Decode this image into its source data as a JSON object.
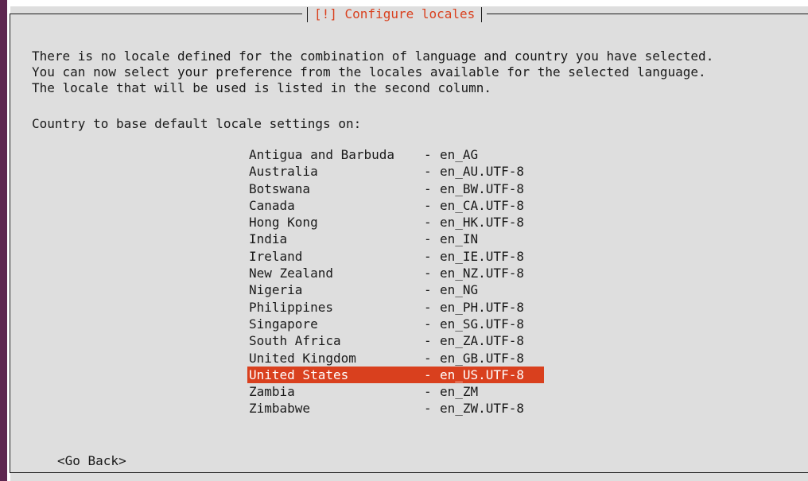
{
  "dialog": {
    "title": "[!] Configure locales",
    "description_lines": [
      "There is no locale defined for the combination of language and country you have selected.",
      "You can now select your preference from the locales available for the selected language.",
      "The locale that will be used is listed in the second column."
    ],
    "prompt": "Country to base default locale settings on:",
    "separator": "-",
    "selected_country": "United States",
    "locales": [
      {
        "country": "Antigua and Barbuda",
        "locale": "en_AG"
      },
      {
        "country": "Australia",
        "locale": "en_AU.UTF-8"
      },
      {
        "country": "Botswana",
        "locale": "en_BW.UTF-8"
      },
      {
        "country": "Canada",
        "locale": "en_CA.UTF-8"
      },
      {
        "country": "Hong Kong",
        "locale": "en_HK.UTF-8"
      },
      {
        "country": "India",
        "locale": "en_IN"
      },
      {
        "country": "Ireland",
        "locale": "en_IE.UTF-8"
      },
      {
        "country": "New Zealand",
        "locale": "en_NZ.UTF-8"
      },
      {
        "country": "Nigeria",
        "locale": "en_NG"
      },
      {
        "country": "Philippines",
        "locale": "en_PH.UTF-8"
      },
      {
        "country": "Singapore",
        "locale": "en_SG.UTF-8"
      },
      {
        "country": "South Africa",
        "locale": "en_ZA.UTF-8"
      },
      {
        "country": "United Kingdom",
        "locale": "en_GB.UTF-8"
      },
      {
        "country": "United States",
        "locale": "en_US.UTF-8"
      },
      {
        "country": "Zambia",
        "locale": "en_ZM"
      },
      {
        "country": "Zimbabwe",
        "locale": "en_ZW.UTF-8"
      }
    ],
    "go_back_label": "<Go Back>"
  },
  "colors": {
    "accent": "#d9401e",
    "dialog_background": "#dedede",
    "side_bar": "#5e2750",
    "text": "#1a1a1a"
  }
}
